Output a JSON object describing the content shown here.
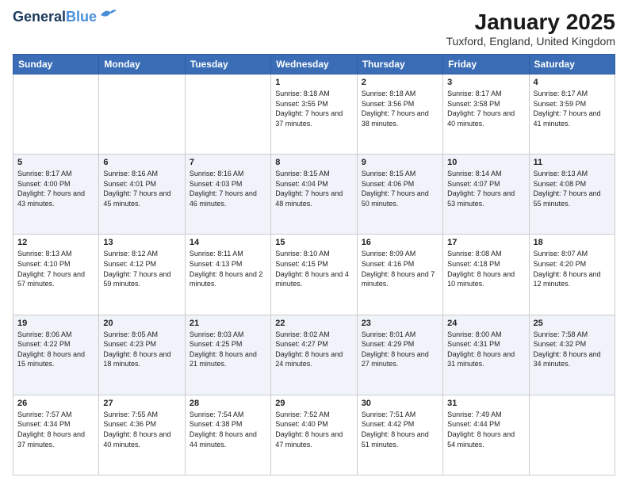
{
  "header": {
    "logo_line1": "General",
    "logo_line2": "Blue",
    "title": "January 2025",
    "subtitle": "Tuxford, England, United Kingdom"
  },
  "days_of_week": [
    "Sunday",
    "Monday",
    "Tuesday",
    "Wednesday",
    "Thursday",
    "Friday",
    "Saturday"
  ],
  "weeks": [
    [
      {
        "day": "",
        "info": ""
      },
      {
        "day": "",
        "info": ""
      },
      {
        "day": "",
        "info": ""
      },
      {
        "day": "1",
        "info": "Sunrise: 8:18 AM\nSunset: 3:55 PM\nDaylight: 7 hours and 37 minutes."
      },
      {
        "day": "2",
        "info": "Sunrise: 8:18 AM\nSunset: 3:56 PM\nDaylight: 7 hours and 38 minutes."
      },
      {
        "day": "3",
        "info": "Sunrise: 8:17 AM\nSunset: 3:58 PM\nDaylight: 7 hours and 40 minutes."
      },
      {
        "day": "4",
        "info": "Sunrise: 8:17 AM\nSunset: 3:59 PM\nDaylight: 7 hours and 41 minutes."
      }
    ],
    [
      {
        "day": "5",
        "info": "Sunrise: 8:17 AM\nSunset: 4:00 PM\nDaylight: 7 hours and 43 minutes."
      },
      {
        "day": "6",
        "info": "Sunrise: 8:16 AM\nSunset: 4:01 PM\nDaylight: 7 hours and 45 minutes."
      },
      {
        "day": "7",
        "info": "Sunrise: 8:16 AM\nSunset: 4:03 PM\nDaylight: 7 hours and 46 minutes."
      },
      {
        "day": "8",
        "info": "Sunrise: 8:15 AM\nSunset: 4:04 PM\nDaylight: 7 hours and 48 minutes."
      },
      {
        "day": "9",
        "info": "Sunrise: 8:15 AM\nSunset: 4:06 PM\nDaylight: 7 hours and 50 minutes."
      },
      {
        "day": "10",
        "info": "Sunrise: 8:14 AM\nSunset: 4:07 PM\nDaylight: 7 hours and 53 minutes."
      },
      {
        "day": "11",
        "info": "Sunrise: 8:13 AM\nSunset: 4:08 PM\nDaylight: 7 hours and 55 minutes."
      }
    ],
    [
      {
        "day": "12",
        "info": "Sunrise: 8:13 AM\nSunset: 4:10 PM\nDaylight: 7 hours and 57 minutes."
      },
      {
        "day": "13",
        "info": "Sunrise: 8:12 AM\nSunset: 4:12 PM\nDaylight: 7 hours and 59 minutes."
      },
      {
        "day": "14",
        "info": "Sunrise: 8:11 AM\nSunset: 4:13 PM\nDaylight: 8 hours and 2 minutes."
      },
      {
        "day": "15",
        "info": "Sunrise: 8:10 AM\nSunset: 4:15 PM\nDaylight: 8 hours and 4 minutes."
      },
      {
        "day": "16",
        "info": "Sunrise: 8:09 AM\nSunset: 4:16 PM\nDaylight: 8 hours and 7 minutes."
      },
      {
        "day": "17",
        "info": "Sunrise: 8:08 AM\nSunset: 4:18 PM\nDaylight: 8 hours and 10 minutes."
      },
      {
        "day": "18",
        "info": "Sunrise: 8:07 AM\nSunset: 4:20 PM\nDaylight: 8 hours and 12 minutes."
      }
    ],
    [
      {
        "day": "19",
        "info": "Sunrise: 8:06 AM\nSunset: 4:22 PM\nDaylight: 8 hours and 15 minutes."
      },
      {
        "day": "20",
        "info": "Sunrise: 8:05 AM\nSunset: 4:23 PM\nDaylight: 8 hours and 18 minutes."
      },
      {
        "day": "21",
        "info": "Sunrise: 8:03 AM\nSunset: 4:25 PM\nDaylight: 8 hours and 21 minutes."
      },
      {
        "day": "22",
        "info": "Sunrise: 8:02 AM\nSunset: 4:27 PM\nDaylight: 8 hours and 24 minutes."
      },
      {
        "day": "23",
        "info": "Sunrise: 8:01 AM\nSunset: 4:29 PM\nDaylight: 8 hours and 27 minutes."
      },
      {
        "day": "24",
        "info": "Sunrise: 8:00 AM\nSunset: 4:31 PM\nDaylight: 8 hours and 31 minutes."
      },
      {
        "day": "25",
        "info": "Sunrise: 7:58 AM\nSunset: 4:32 PM\nDaylight: 8 hours and 34 minutes."
      }
    ],
    [
      {
        "day": "26",
        "info": "Sunrise: 7:57 AM\nSunset: 4:34 PM\nDaylight: 8 hours and 37 minutes."
      },
      {
        "day": "27",
        "info": "Sunrise: 7:55 AM\nSunset: 4:36 PM\nDaylight: 8 hours and 40 minutes."
      },
      {
        "day": "28",
        "info": "Sunrise: 7:54 AM\nSunset: 4:38 PM\nDaylight: 8 hours and 44 minutes."
      },
      {
        "day": "29",
        "info": "Sunrise: 7:52 AM\nSunset: 4:40 PM\nDaylight: 8 hours and 47 minutes."
      },
      {
        "day": "30",
        "info": "Sunrise: 7:51 AM\nSunset: 4:42 PM\nDaylight: 8 hours and 51 minutes."
      },
      {
        "day": "31",
        "info": "Sunrise: 7:49 AM\nSunset: 4:44 PM\nDaylight: 8 hours and 54 minutes."
      },
      {
        "day": "",
        "info": ""
      }
    ]
  ]
}
